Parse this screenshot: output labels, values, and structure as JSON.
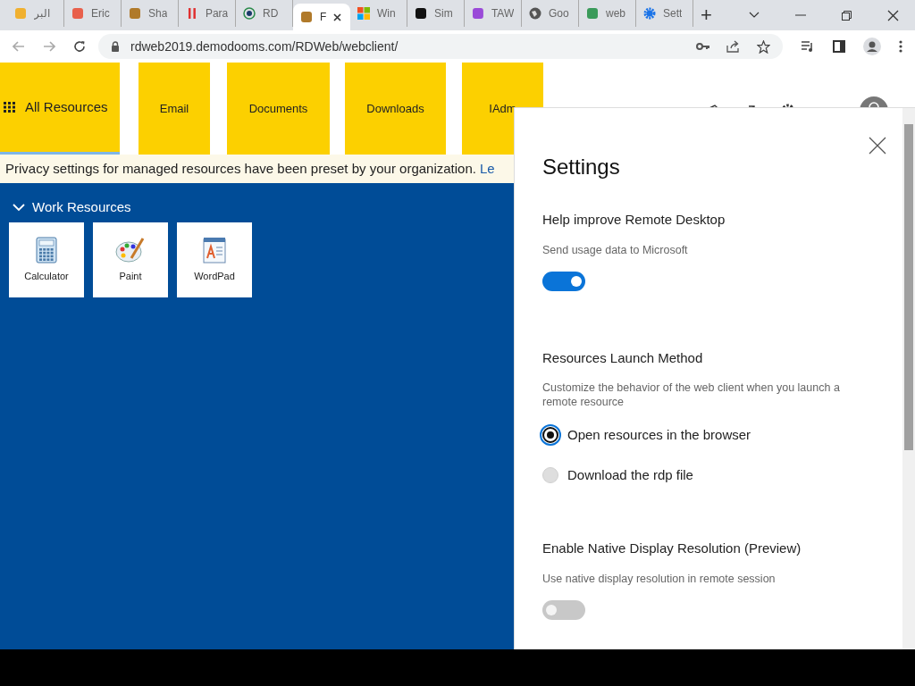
{
  "browser": {
    "tabs": [
      {
        "title": "البر",
        "selected": false
      },
      {
        "title": "Eric",
        "selected": false
      },
      {
        "title": "Sha",
        "selected": false
      },
      {
        "title": "Para",
        "selected": false
      },
      {
        "title": "RD",
        "selected": false
      },
      {
        "title": "F",
        "selected": true
      },
      {
        "title": "Win",
        "selected": false
      },
      {
        "title": "Sim",
        "selected": false
      },
      {
        "title": "TAW",
        "selected": false
      },
      {
        "title": "Goo",
        "selected": false
      },
      {
        "title": "web",
        "selected": false
      },
      {
        "title": "Sett",
        "selected": false
      }
    ],
    "new_tab": "+",
    "url": "rdweb2019.demodooms.com/RDWeb/webclient/"
  },
  "header": {
    "tabs": [
      {
        "label": "All Resources",
        "selected": true
      },
      {
        "label": "Email",
        "selected": false
      },
      {
        "label": "Documents",
        "selected": false
      },
      {
        "label": "Downloads",
        "selected": false
      },
      {
        "label": "IAdm",
        "selected": false
      }
    ]
  },
  "banner": {
    "text": "Privacy settings for managed resources have been preset by your organization.",
    "link": "Le"
  },
  "group": {
    "title": "Work Resources",
    "expanded": true,
    "apps": [
      {
        "name": "Calculator"
      },
      {
        "name": "Paint"
      },
      {
        "name": "WordPad"
      }
    ]
  },
  "settings": {
    "title": "Settings",
    "sections": [
      {
        "kind": "toggle",
        "heading": "Help improve Remote Desktop",
        "description": "Send usage data to Microsoft",
        "on": true
      },
      {
        "kind": "radio",
        "heading": "Resources Launch Method",
        "description": "Customize the behavior of the web client when you launch a remote resource",
        "options": [
          {
            "label": "Open resources in the browser",
            "selected": true
          },
          {
            "label": "Download the rdp file",
            "selected": false
          }
        ]
      },
      {
        "kind": "toggle",
        "heading": "Enable Native Display Resolution (Preview)",
        "description": "Use native display resolution in remote session",
        "on": false
      }
    ]
  }
}
